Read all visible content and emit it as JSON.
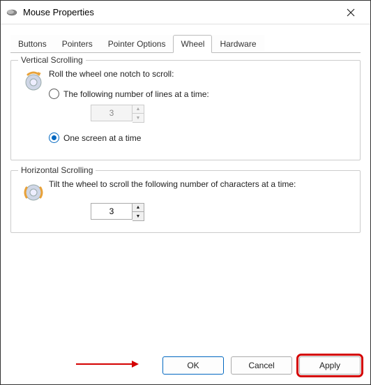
{
  "window": {
    "title": "Mouse Properties"
  },
  "tabs": {
    "items": [
      {
        "label": "Buttons"
      },
      {
        "label": "Pointers"
      },
      {
        "label": "Pointer Options"
      },
      {
        "label": "Wheel"
      },
      {
        "label": "Hardware"
      }
    ],
    "active_index": 3
  },
  "vertical_scrolling": {
    "group_title": "Vertical Scrolling",
    "instruction": "Roll the wheel one notch to scroll:",
    "option_lines": {
      "label": "The following number of lines at a time:",
      "value": "3",
      "selected": false
    },
    "option_screen": {
      "label": "One screen at a time",
      "selected": true
    }
  },
  "horizontal_scrolling": {
    "group_title": "Horizontal Scrolling",
    "instruction": "Tilt the wheel to scroll the following number of characters at a time:",
    "value": "3"
  },
  "footer": {
    "ok": "OK",
    "cancel": "Cancel",
    "apply": "Apply"
  }
}
